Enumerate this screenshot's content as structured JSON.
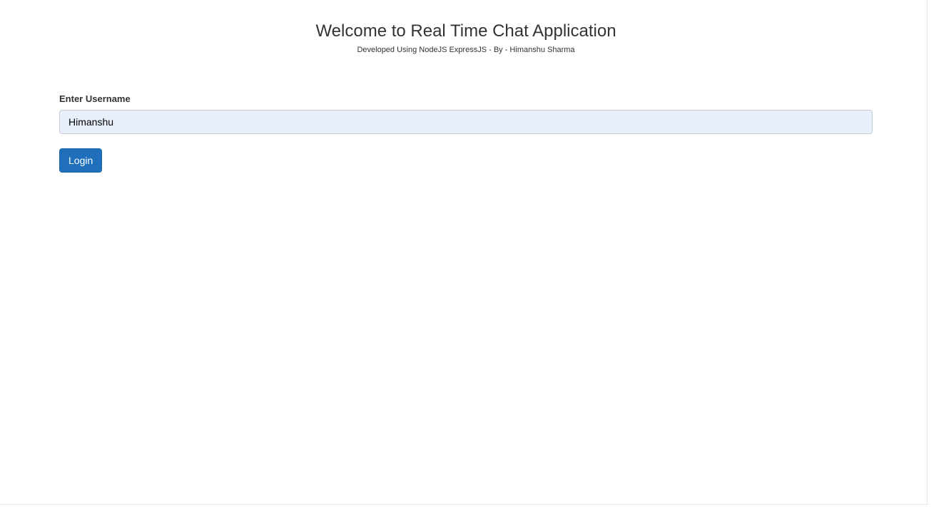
{
  "header": {
    "title": "Welcome to Real Time Chat Application",
    "subtitle": "Developed Using NodeJS ExpressJS - By - Himanshu Sharma"
  },
  "login_form": {
    "username_label": "Enter Username",
    "username_value": "Himanshu",
    "login_button": "Login"
  },
  "colors": {
    "primary_button": "#1f6fba",
    "input_background": "#e8f0fe",
    "text": "#333333"
  }
}
